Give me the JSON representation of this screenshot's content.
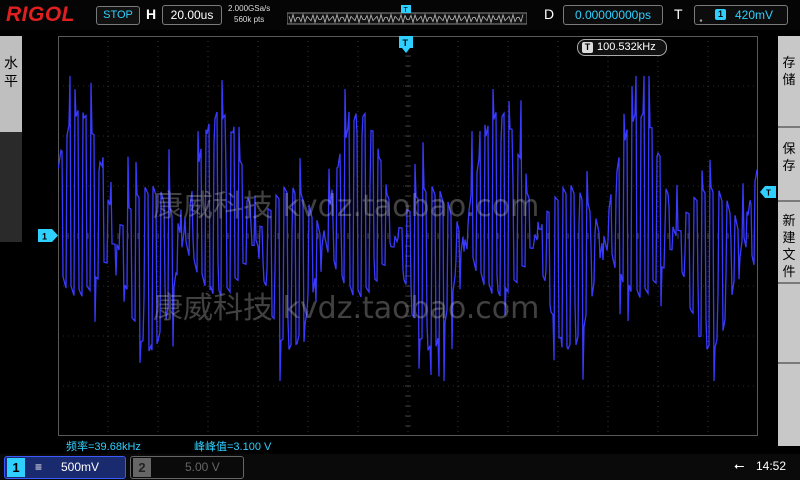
{
  "header": {
    "logo": "RIGOL",
    "run_status": "STOP",
    "horizontal_label": "H",
    "timebase": "20.00us",
    "sample_rate": "2.000GSa/s",
    "memory_depth": "560k pts",
    "delay_label": "D",
    "delay_value": "0.00000000ps",
    "trigger_label": "T",
    "trigger_edge_icon": "rising-edge",
    "trigger_source": "1",
    "trigger_level": "420mV"
  },
  "side_menu_left": {
    "label": "水平"
  },
  "side_menu_right": {
    "items": [
      "存储",
      "保存",
      "新建文件"
    ]
  },
  "display": {
    "frequency_badge_marker": "T",
    "frequency_badge_value": "100.532kHz",
    "channel_marker": "1",
    "trigger_position_marker": "T",
    "watermark": "康威科技 kvdz.taobao.com"
  },
  "measurements": {
    "frequency": "频率=39.68kHz",
    "peak_to_peak": "峰峰值=3.100 V"
  },
  "bottom": {
    "ch1_number": "1",
    "ch1_coupling": "≡",
    "ch1_scale": "500mV",
    "ch2_number": "2",
    "ch2_scale": "5.00 V",
    "clock": "14:52"
  },
  "colors": {
    "background": "#000000",
    "grid": "#5a5a5a",
    "trace": "#3a3aff",
    "accent": "#2fd0ff",
    "logo": "#e02020"
  }
}
